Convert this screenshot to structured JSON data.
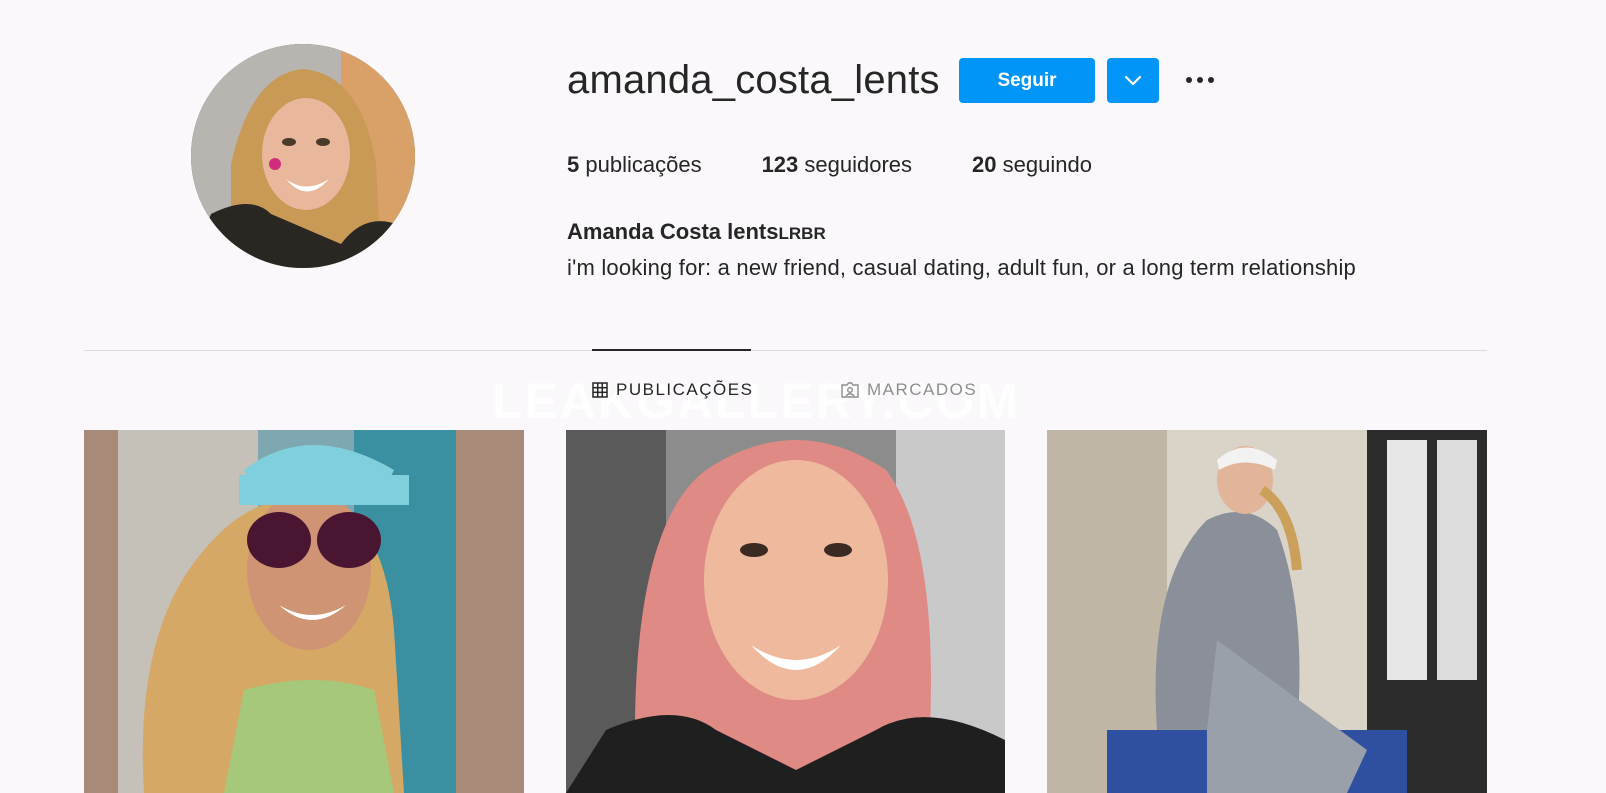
{
  "profile": {
    "username": "amanda_costa_lents",
    "follow_label": "Seguir",
    "full_name": "Amanda Costa lents",
    "full_name_suffix": "LRBR",
    "bio": "i'm looking for: a new friend, casual dating, adult fun, or a long term relationship",
    "avatar_alt": "profile photo"
  },
  "stats": {
    "posts_count": "5",
    "posts_label": "publicações",
    "followers_count": "123",
    "followers_label": "seguidores",
    "following_count": "20",
    "following_label": "seguindo"
  },
  "tabs": [
    {
      "label": "PUBLICAÇÕES",
      "icon": "grid-icon",
      "active": true
    },
    {
      "label": "MARCADOS",
      "icon": "tagged-icon",
      "active": false
    }
  ],
  "watermark": "LEAKGALLERY.COM",
  "posts": [
    {
      "alt": "selfie with sunglasses and cap on a dock"
    },
    {
      "alt": "close-up selfie with pink hair"
    },
    {
      "alt": "sitting by a window in a checkered jacket"
    }
  ],
  "colors": {
    "accent": "#0095f6",
    "background": "#faf8fb",
    "text": "#262626",
    "muted": "#8e8e8e"
  }
}
